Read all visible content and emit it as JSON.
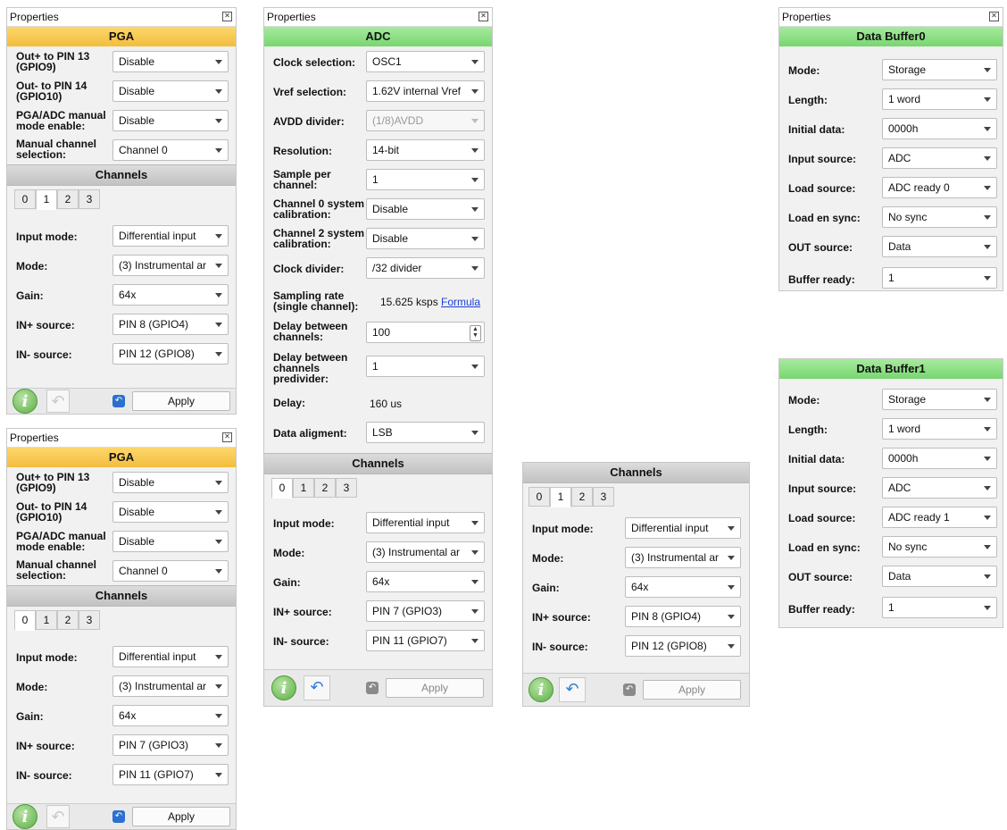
{
  "common": {
    "properties_title": "Properties",
    "apply_label": "Apply",
    "channels_header": "Channels",
    "tabs": [
      "0",
      "1",
      "2",
      "3"
    ],
    "close_glyph": "✕",
    "info_glyph": "i",
    "undo_glyph": "↶",
    "small_undo_glyph": "↶"
  },
  "pga1": {
    "header": "PGA",
    "fields": [
      {
        "label": "Out+ to PIN 13 (GPIO9)",
        "value": "Disable"
      },
      {
        "label": "Out- to PIN 14 (GPIO10)",
        "value": "Disable"
      },
      {
        "label": "PGA/ADC manual mode enable:",
        "value": "Disable"
      },
      {
        "label": "Manual channel selection:",
        "value": "Channel 0"
      }
    ],
    "active_tab": "1",
    "channel_fields": [
      {
        "label": "Input mode:",
        "value": "Differential input"
      },
      {
        "label": "Mode:",
        "value": "(3) Instrumental ar"
      },
      {
        "label": "Gain:",
        "value": "64x"
      },
      {
        "label": "IN+ source:",
        "value": "PIN 8 (GPIO4)"
      },
      {
        "label": "IN- source:",
        "value": "PIN 12 (GPIO8)"
      }
    ]
  },
  "pga2": {
    "header": "PGA",
    "fields": [
      {
        "label": "Out+ to PIN 13 (GPIO9)",
        "value": "Disable"
      },
      {
        "label": "Out- to PIN 14 (GPIO10)",
        "value": "Disable"
      },
      {
        "label": "PGA/ADC manual mode enable:",
        "value": "Disable"
      },
      {
        "label": "Manual channel selection:",
        "value": "Channel 0"
      }
    ],
    "active_tab": "0",
    "channel_fields": [
      {
        "label": "Input mode:",
        "value": "Differential input"
      },
      {
        "label": "Mode:",
        "value": "(3) Instrumental ar"
      },
      {
        "label": "Gain:",
        "value": "64x"
      },
      {
        "label": "IN+ source:",
        "value": "PIN 7 (GPIO3)"
      },
      {
        "label": "IN- source:",
        "value": "PIN 11 (GPIO7)"
      }
    ]
  },
  "adc": {
    "header": "ADC",
    "clock_selection": {
      "label": "Clock selection:",
      "value": "OSC1"
    },
    "vref_selection": {
      "label": "Vref selection:",
      "value": "1.62V internal Vref"
    },
    "avdd_divider": {
      "label": "AVDD divider:",
      "value": "(1/8)AVDD"
    },
    "resolution": {
      "label": "Resolution:",
      "value": "14-bit"
    },
    "sample_per_channel": {
      "label": "Sample per channel:",
      "value": "1"
    },
    "ch0_calibration": {
      "label": "Channel 0 system calibration:",
      "value": "Disable"
    },
    "ch2_calibration": {
      "label": "Channel 2 system calibration:",
      "value": "Disable"
    },
    "clock_divider": {
      "label": "Clock divider:",
      "value": "/32 divider"
    },
    "sampling_rate": {
      "label": "Sampling rate (single channel):",
      "value": "15.625 ksps",
      "link": "Formula"
    },
    "delay_between": {
      "label": "Delay between channels:",
      "value": "100"
    },
    "delay_predivider": {
      "label": "Delay between channels predivider:",
      "value": "1"
    },
    "delay": {
      "label": "Delay:",
      "value": "160 us"
    },
    "data_alignment": {
      "label": "Data aligment:",
      "value": "LSB"
    },
    "active_tab": "0",
    "channel_fields": [
      {
        "label": "Input mode:",
        "value": "Differential input"
      },
      {
        "label": "Mode:",
        "value": "(3) Instrumental ar"
      },
      {
        "label": "Gain:",
        "value": "64x"
      },
      {
        "label": "IN+ source:",
        "value": "PIN 7 (GPIO3)"
      },
      {
        "label": "IN- source:",
        "value": "PIN 11 (GPIO7)"
      }
    ]
  },
  "channels_panel": {
    "active_tab": "1",
    "channel_fields": [
      {
        "label": "Input mode:",
        "value": "Differential input"
      },
      {
        "label": "Mode:",
        "value": "(3) Instrumental ar"
      },
      {
        "label": "Gain:",
        "value": "64x"
      },
      {
        "label": "IN+ source:",
        "value": "PIN 8 (GPIO4)"
      },
      {
        "label": "IN- source:",
        "value": "PIN 12 (GPIO8)"
      }
    ]
  },
  "buffer0": {
    "header": "Data Buffer0",
    "fields": [
      {
        "label": "Mode:",
        "value": "Storage"
      },
      {
        "label": "Length:",
        "value": "1 word"
      },
      {
        "label": "Initial data:",
        "value": "0000h"
      },
      {
        "label": "Input source:",
        "value": "ADC"
      },
      {
        "label": "Load source:",
        "value": "ADC ready 0"
      },
      {
        "label": "Load en sync:",
        "value": "No sync"
      },
      {
        "label": "OUT source:",
        "value": "Data"
      },
      {
        "label": "Buffer ready:",
        "value": "1"
      }
    ]
  },
  "buffer1": {
    "header": "Data Buffer1",
    "fields": [
      {
        "label": "Mode:",
        "value": "Storage"
      },
      {
        "label": "Length:",
        "value": "1 word"
      },
      {
        "label": "Initial data:",
        "value": "0000h"
      },
      {
        "label": "Input source:",
        "value": "ADC"
      },
      {
        "label": "Load source:",
        "value": "ADC ready 1"
      },
      {
        "label": "Load en sync:",
        "value": "No sync"
      },
      {
        "label": "OUT source:",
        "value": "Data"
      },
      {
        "label": "Buffer ready:",
        "value": "1"
      }
    ]
  },
  "colors": {
    "pga_header": "#f3bd3d",
    "adc_header": "#79d670",
    "channels_header": "#c2c2c2",
    "info_button": "#5cae45",
    "undo_blue": "#2f7ed8",
    "link": "#1a3fd6"
  },
  "icons": {
    "info": "info-icon",
    "undo": "undo-icon",
    "close": "close-icon",
    "dropdown": "chevron-down-icon"
  }
}
